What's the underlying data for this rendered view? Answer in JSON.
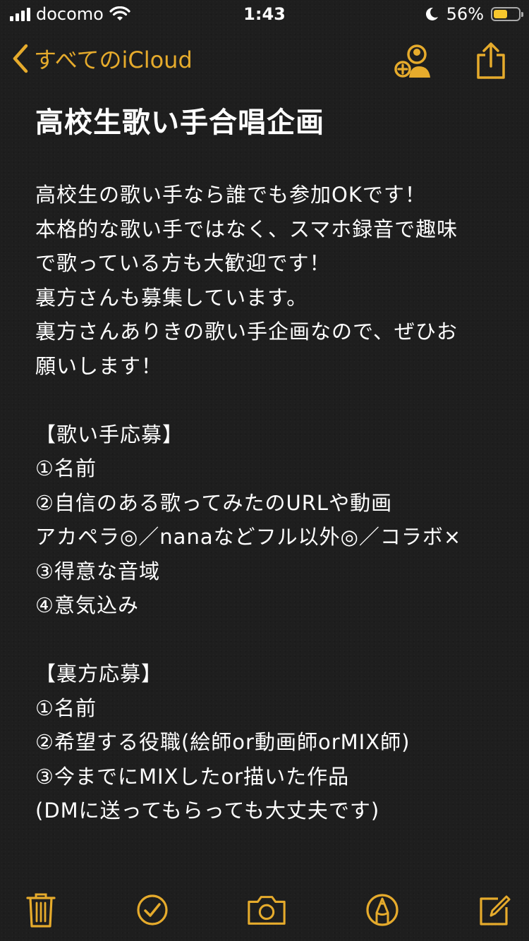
{
  "status_bar": {
    "carrier": "docomo",
    "time": "1:43",
    "battery_percent": "56%",
    "battery_level": 0.56,
    "icons": [
      "signal-icon",
      "wifi-icon",
      "moon-icon",
      "battery-icon"
    ]
  },
  "nav": {
    "back_label": "すべてのiCloud",
    "accent_color": "#e6ab2c",
    "icons": [
      "chevron-left-icon",
      "add-person-icon",
      "share-icon"
    ]
  },
  "note": {
    "title": "高校生歌い手合唱企画",
    "lines": [
      "高校生の歌い手なら誰でも参加OKです！",
      "本格的な歌い手ではなく、スマホ録音で趣味",
      "で歌っている方も大歓迎です！",
      "裏方さんも募集しています。",
      "裏方さんありきの歌い手企画なので、ぜひお",
      "願いします！",
      "",
      "【歌い手応募】",
      "①名前",
      "②自信のある歌ってみたのURLや動画",
      "アカペラ◎／nanaなどフル以外◎／コラボ×",
      "③得意な音域",
      "④意気込み",
      "",
      "【裏方応募】",
      "①名前",
      "②希望する役職(絵師or動画師orMIX師)",
      "③今までにMIXしたor描いた作品",
      "(DMに送ってもらっても大丈夫です)"
    ]
  },
  "toolbar": {
    "icons": [
      "trash-icon",
      "checklist-icon",
      "camera-icon",
      "markup-icon",
      "compose-icon"
    ]
  }
}
